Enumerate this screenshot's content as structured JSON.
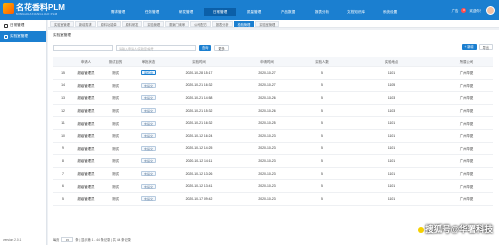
{
  "header": {
    "logo_title": "名花香料PLM",
    "logo_sub": "MINGHUAXIANGLIAO PLM",
    "nav": [
      "需求管理",
      "任务管理",
      "研发管理",
      "日常管理",
      "质量管理",
      "产品数据",
      "报表分析",
      "文档知识库",
      "系统设置"
    ],
    "active_nav_index": 3,
    "user_label": "广告",
    "notif_count": "0",
    "welcome": "欢迎你！"
  },
  "sidebar": {
    "items": [
      "日常管理",
      "实验室管理"
    ],
    "active_index": 1,
    "version": "version 2.0.1"
  },
  "tabs": [
    "实验室管理",
    "新增需求",
    "原料功能单",
    "原料研发",
    "实验管理",
    "委案门询审",
    "公司配方",
    "报表分析",
    "检验管理",
    "实验室管理"
  ],
  "active_tab_index": 8,
  "page": {
    "title": "实验室管理"
  },
  "filter": {
    "select_placeholder": "",
    "search_placeholder": "请输入申请人/实验室/编号",
    "query_label": "查询",
    "more_label": "更多"
  },
  "tools": {
    "add_label": "+ 新增",
    "export_label": "导出"
  },
  "table": {
    "columns": [
      "",
      "申请人",
      "测试目的",
      "审批状态",
      "实验时间",
      "申请时间",
      "实验人数",
      "实验地点",
      "所属公司"
    ],
    "rows": [
      [
        "15",
        "超级管理员",
        "测试",
        "审核中",
        "2020-10-28 15:17",
        "2020-10-27",
        "5",
        "1101",
        "广州华夏"
      ],
      [
        "14",
        "超级管理员",
        "测试",
        "未提交",
        "2020-10-21 16:32",
        "2020-10-27",
        "5",
        "1105",
        "广州华夏"
      ],
      [
        "13",
        "超级管理员",
        "测试",
        "未提交",
        "2020-10-21 14:58",
        "2020-10-26",
        "5",
        "1103",
        "广州华夏"
      ],
      [
        "12",
        "超级管理员",
        "测试",
        "未提交",
        "2020-10-21 15:32",
        "2020-10-26",
        "5",
        "1103",
        "广州华夏"
      ],
      [
        "11",
        "超级管理员",
        "测试",
        "未提交",
        "2020-10-21 16:32",
        "2020-10-25",
        "5",
        "1101",
        "广州华夏"
      ],
      [
        "10",
        "超级管理员",
        "测试",
        "未提交",
        "2020-10-12 16:24",
        "2020-10-23",
        "5",
        "1101",
        "广州华夏"
      ],
      [
        "9",
        "超级管理员",
        "测试",
        "未提交",
        "2020-10-12 14:25",
        "2020-10-23",
        "5",
        "1101",
        "广州华夏"
      ],
      [
        "8",
        "超级管理员",
        "测试",
        "未提交",
        "2020-10-12 14:11",
        "2020-10-23",
        "5",
        "1101",
        "广州华夏"
      ],
      [
        "7",
        "超级管理员",
        "测试",
        "未提交",
        "2020-10-12 13:26",
        "2020-10-23",
        "5",
        "1101",
        "广州华夏"
      ],
      [
        "6",
        "超级管理员",
        "测试",
        "未提交",
        "2020-10-12 13:41",
        "2020-10-23",
        "5",
        "1101",
        "广州华夏"
      ],
      [
        "5",
        "超级管理员",
        "测试",
        "未提交",
        "2020-10-17 09:42",
        "2020-10-23",
        "5",
        "1101",
        "广州华夏"
      ]
    ],
    "highlight_status": "审核中"
  },
  "pager": {
    "prefix": "每页",
    "page_size": "15",
    "info": "条 | 显示第 1 - 44 条记录 | 共 44 条记录"
  },
  "watermark": "搜狐号@华署科技"
}
